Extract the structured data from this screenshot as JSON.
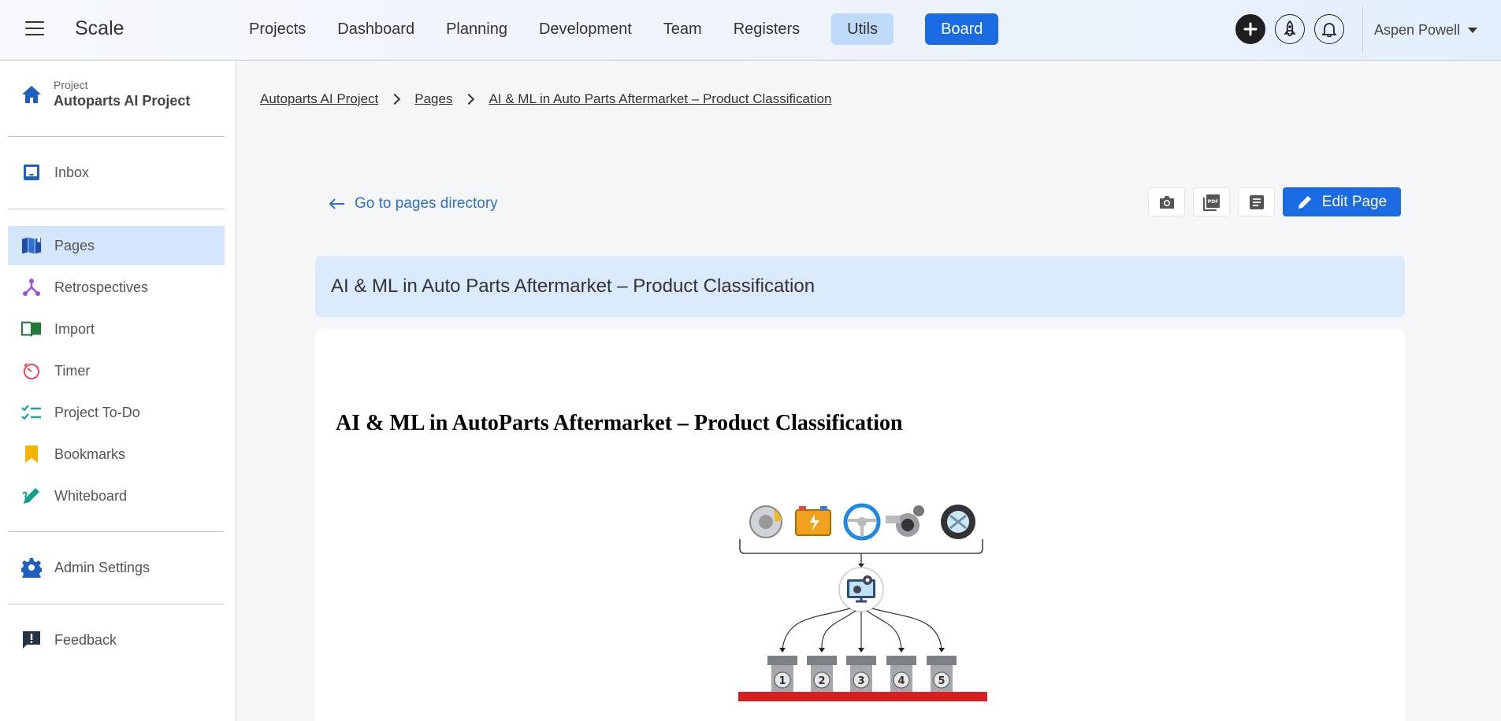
{
  "app": {
    "brand": "Scale"
  },
  "nav": {
    "items": [
      "Projects",
      "Dashboard",
      "Planning",
      "Development",
      "Team",
      "Registers"
    ],
    "utils": "Utils",
    "board": "Board"
  },
  "user": {
    "name": "Aspen Powell"
  },
  "sidebar": {
    "project_caption": "Project",
    "project_name": "Autoparts AI Project",
    "inbox": "Inbox",
    "items": [
      {
        "label": "Pages",
        "icon": "book-icon"
      },
      {
        "label": "Retrospectives",
        "icon": "retro-icon"
      },
      {
        "label": "Import",
        "icon": "import-icon"
      },
      {
        "label": "Timer",
        "icon": "timer-icon"
      },
      {
        "label": "Project To-Do",
        "icon": "checklist-icon"
      },
      {
        "label": "Bookmarks",
        "icon": "bookmark-icon"
      },
      {
        "label": "Whiteboard",
        "icon": "whiteboard-icon"
      }
    ],
    "admin": "Admin Settings",
    "feedback": "Feedback"
  },
  "breadcrumb": {
    "project": "Autoparts AI Project",
    "pages": "Pages",
    "current": "AI & ML in Auto Parts Aftermarket – Product Classification"
  },
  "page": {
    "back_link": "Go to pages directory",
    "edit_label": "Edit Page",
    "title": "AI & ML in Auto Parts Aftermarket – Product Classification",
    "doc_heading": "AI & ML in AutoParts Aftermarket – Product Classification",
    "diagram_bins": [
      "1",
      "2",
      "3",
      "4",
      "5"
    ]
  },
  "colors": {
    "accent": "#1a6be2",
    "active_bg": "#d4e6fb",
    "title_bg": "#dbe9fc"
  }
}
